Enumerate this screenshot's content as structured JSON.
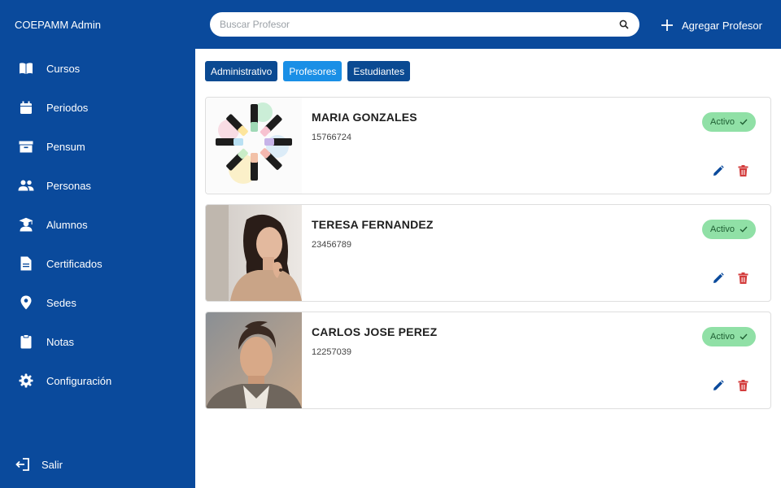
{
  "app": {
    "title": "COEPAMM Admin"
  },
  "sidebar": {
    "items": [
      {
        "label": "Cursos",
        "icon": "book-icon"
      },
      {
        "label": "Periodos",
        "icon": "calendar-icon"
      },
      {
        "label": "Pensum",
        "icon": "archive-box-icon"
      },
      {
        "label": "Personas",
        "icon": "people-icon"
      },
      {
        "label": "Alumnos",
        "icon": "student-icon"
      },
      {
        "label": "Certificados",
        "icon": "document-icon"
      },
      {
        "label": "Sedes",
        "icon": "location-pin-icon"
      },
      {
        "label": "Notas",
        "icon": "clipboard-icon"
      },
      {
        "label": "Configuración",
        "icon": "gear-icon"
      }
    ],
    "logout_label": "Salir"
  },
  "header": {
    "search_placeholder": "Buscar Profesor",
    "add_label": "Agregar Profesor"
  },
  "tabs": [
    {
      "label": "Administrativo",
      "active": false
    },
    {
      "label": "Profesores",
      "active": true
    },
    {
      "label": "Estudiantes",
      "active": false
    }
  ],
  "teachers": [
    {
      "name": "MARIA GONZALES",
      "id": "15766724",
      "status": "Activo"
    },
    {
      "name": "TERESA FERNANDEZ",
      "id": "23456789",
      "status": "Activo"
    },
    {
      "name": "CARLOS JOSE PEREZ",
      "id": "12257039",
      "status": "Activo"
    }
  ],
  "colors": {
    "primary": "#0a4a9c",
    "tab": "#0b4a92",
    "tab_active": "#1a8fe6",
    "badge_bg": "#90e0a6",
    "edit": "#0a4a9c",
    "delete": "#d33c3c"
  }
}
